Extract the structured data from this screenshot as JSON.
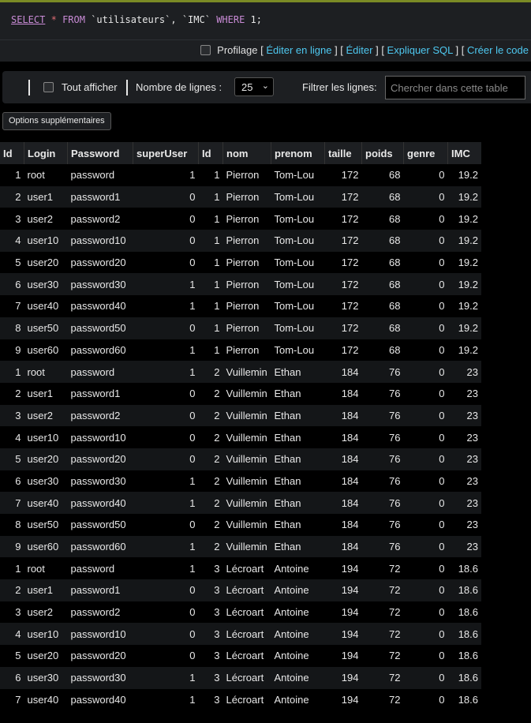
{
  "sql": {
    "select": "SELECT",
    "star": "*",
    "from": "FROM",
    "table1": "`utilisateurs`",
    "comma": ",",
    "table2": "`IMC`",
    "where": "WHERE",
    "value": "1",
    "semicolon": ";"
  },
  "tools": {
    "profilage": "Profilage",
    "links": [
      "Éditer en ligne",
      "Éditer",
      "Expliquer SQL",
      "Créer le code"
    ]
  },
  "nav": {
    "show_all": "Tout afficher",
    "rows_label": "Nombre de lignes :",
    "rows_value": "25",
    "filter_label": "Filtrer les lignes:",
    "filter_placeholder": "Chercher dans cette table"
  },
  "options_button": "Options supplémentaires",
  "table": {
    "columns": [
      "Id",
      "Login",
      "Password",
      "superUser",
      "Id",
      "nom",
      "prenom",
      "taille",
      "poids",
      "genre",
      "IMC"
    ],
    "rows": [
      [
        "1",
        "root",
        "password",
        "1",
        "1",
        "Pierron",
        "Tom-Lou",
        "172",
        "68",
        "0",
        "19.2"
      ],
      [
        "2",
        "user1",
        "password1",
        "0",
        "1",
        "Pierron",
        "Tom-Lou",
        "172",
        "68",
        "0",
        "19.2"
      ],
      [
        "3",
        "user2",
        "password2",
        "0",
        "1",
        "Pierron",
        "Tom-Lou",
        "172",
        "68",
        "0",
        "19.2"
      ],
      [
        "4",
        "user10",
        "password10",
        "0",
        "1",
        "Pierron",
        "Tom-Lou",
        "172",
        "68",
        "0",
        "19.2"
      ],
      [
        "5",
        "user20",
        "password20",
        "0",
        "1",
        "Pierron",
        "Tom-Lou",
        "172",
        "68",
        "0",
        "19.2"
      ],
      [
        "6",
        "user30",
        "password30",
        "1",
        "1",
        "Pierron",
        "Tom-Lou",
        "172",
        "68",
        "0",
        "19.2"
      ],
      [
        "7",
        "user40",
        "password40",
        "1",
        "1",
        "Pierron",
        "Tom-Lou",
        "172",
        "68",
        "0",
        "19.2"
      ],
      [
        "8",
        "user50",
        "password50",
        "0",
        "1",
        "Pierron",
        "Tom-Lou",
        "172",
        "68",
        "0",
        "19.2"
      ],
      [
        "9",
        "user60",
        "password60",
        "1",
        "1",
        "Pierron",
        "Tom-Lou",
        "172",
        "68",
        "0",
        "19.2"
      ],
      [
        "1",
        "root",
        "password",
        "1",
        "2",
        "Vuillemin",
        "Ethan",
        "184",
        "76",
        "0",
        "23"
      ],
      [
        "2",
        "user1",
        "password1",
        "0",
        "2",
        "Vuillemin",
        "Ethan",
        "184",
        "76",
        "0",
        "23"
      ],
      [
        "3",
        "user2",
        "password2",
        "0",
        "2",
        "Vuillemin",
        "Ethan",
        "184",
        "76",
        "0",
        "23"
      ],
      [
        "4",
        "user10",
        "password10",
        "0",
        "2",
        "Vuillemin",
        "Ethan",
        "184",
        "76",
        "0",
        "23"
      ],
      [
        "5",
        "user20",
        "password20",
        "0",
        "2",
        "Vuillemin",
        "Ethan",
        "184",
        "76",
        "0",
        "23"
      ],
      [
        "6",
        "user30",
        "password30",
        "1",
        "2",
        "Vuillemin",
        "Ethan",
        "184",
        "76",
        "0",
        "23"
      ],
      [
        "7",
        "user40",
        "password40",
        "1",
        "2",
        "Vuillemin",
        "Ethan",
        "184",
        "76",
        "0",
        "23"
      ],
      [
        "8",
        "user50",
        "password50",
        "0",
        "2",
        "Vuillemin",
        "Ethan",
        "184",
        "76",
        "0",
        "23"
      ],
      [
        "9",
        "user60",
        "password60",
        "1",
        "2",
        "Vuillemin",
        "Ethan",
        "184",
        "76",
        "0",
        "23"
      ],
      [
        "1",
        "root",
        "password",
        "1",
        "3",
        "Lécroart",
        "Antoine",
        "194",
        "72",
        "0",
        "18.6"
      ],
      [
        "2",
        "user1",
        "password1",
        "0",
        "3",
        "Lécroart",
        "Antoine",
        "194",
        "72",
        "0",
        "18.6"
      ],
      [
        "3",
        "user2",
        "password2",
        "0",
        "3",
        "Lécroart",
        "Antoine",
        "194",
        "72",
        "0",
        "18.6"
      ],
      [
        "4",
        "user10",
        "password10",
        "0",
        "3",
        "Lécroart",
        "Antoine",
        "194",
        "72",
        "0",
        "18.6"
      ],
      [
        "5",
        "user20",
        "password20",
        "0",
        "3",
        "Lécroart",
        "Antoine",
        "194",
        "72",
        "0",
        "18.6"
      ],
      [
        "6",
        "user30",
        "password30",
        "1",
        "3",
        "Lécroart",
        "Antoine",
        "194",
        "72",
        "0",
        "18.6"
      ],
      [
        "7",
        "user40",
        "password40",
        "1",
        "3",
        "Lécroart",
        "Antoine",
        "194",
        "72",
        "0",
        "18.6"
      ]
    ]
  }
}
